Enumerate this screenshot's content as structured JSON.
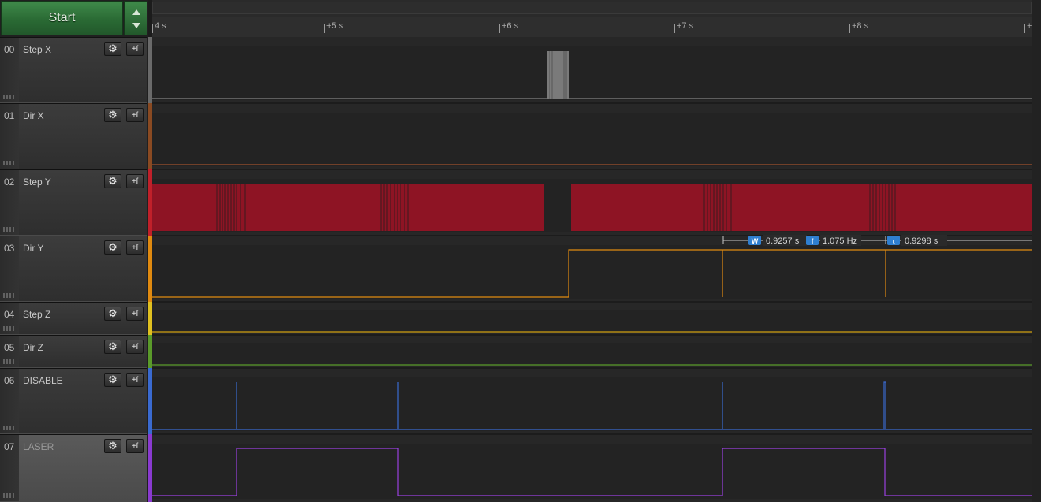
{
  "toolbar": {
    "start_label": "Start",
    "up_icon": "triangle-up-icon",
    "down_icon": "triangle-down-icon"
  },
  "timeline": {
    "ticks": [
      "4 s",
      "+5 s",
      "+6 s",
      "+7 s",
      "+8 s",
      "+"
    ]
  },
  "channels": [
    {
      "num": "00",
      "name": "Step X",
      "color": "#9a9a9a"
    },
    {
      "num": "01",
      "name": "Dir X",
      "color": "#a0522d"
    },
    {
      "num": "02",
      "name": "Step Y",
      "color": "#c0202a"
    },
    {
      "num": "03",
      "name": "Dir Y",
      "color": "#e08a10"
    },
    {
      "num": "04",
      "name": "Step Z",
      "color": "#e0c020"
    },
    {
      "num": "05",
      "name": "Dir Z",
      "color": "#5a9a2a"
    },
    {
      "num": "06",
      "name": "DISABLE",
      "color": "#3a6ad0"
    },
    {
      "num": "07",
      "name": "LASER",
      "color": "#8a3ad0"
    }
  ],
  "channel_buttons": {
    "settings_icon": "gear-icon",
    "trigger_icon": "trigger-icon",
    "trigger_glyph": "+ſ"
  },
  "measurement": {
    "width_badge": "W",
    "width_value": "0.9257 s",
    "freq_badge": "f",
    "freq_value": "1.075 Hz",
    "period_badge": "τ",
    "period_value": "0.9298 s"
  }
}
